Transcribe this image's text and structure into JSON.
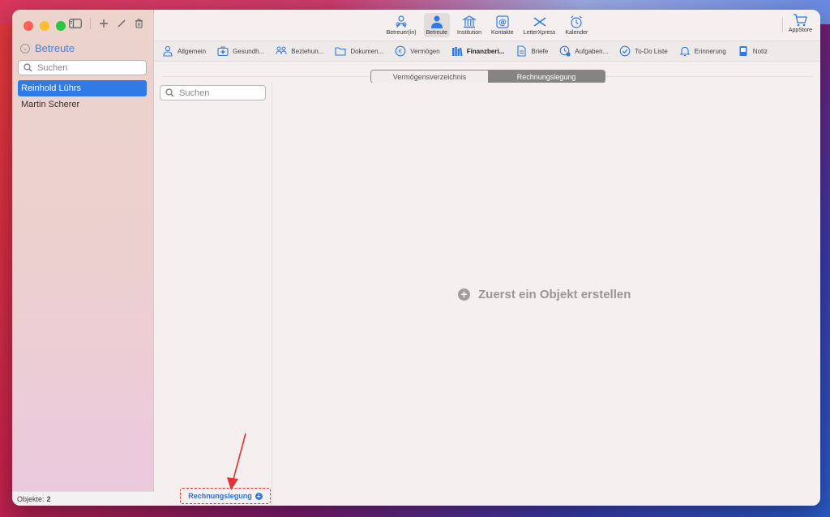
{
  "sidebar": {
    "title": "Betreute",
    "search_placeholder": "Suchen",
    "items": [
      {
        "label": "Reinhold Lührs",
        "selected": true
      },
      {
        "label": "Martin Scherer",
        "selected": false
      }
    ],
    "footer_label": "Objekte:",
    "footer_count": "2"
  },
  "toolbar": {
    "buttons": [
      {
        "label": "Betreuer(in)",
        "icon": "people-icon"
      },
      {
        "label": "Betreute",
        "icon": "person-icon",
        "active": true
      },
      {
        "label": "Institution",
        "icon": "building-icon"
      },
      {
        "label": "Kontakte",
        "icon": "at-icon"
      },
      {
        "label": "LetterXpress",
        "icon": "letterxpress-icon"
      },
      {
        "label": "Kalender",
        "icon": "alarm-icon"
      }
    ],
    "appstore_label": "AppStore"
  },
  "tabs": [
    {
      "label": "Allgemein",
      "icon": "person-outline-icon"
    },
    {
      "label": "Gesundh...",
      "icon": "medical-kit-icon"
    },
    {
      "label": "Beziehun...",
      "icon": "relations-icon"
    },
    {
      "label": "Dokumen...",
      "icon": "folder-icon"
    },
    {
      "label": "Vermögen",
      "icon": "euro-icon"
    },
    {
      "label": "Finanzberi...",
      "icon": "books-icon",
      "active": true
    },
    {
      "label": "Briefe",
      "icon": "document-icon"
    },
    {
      "label": "Aufgaben...",
      "icon": "clock-check-icon"
    },
    {
      "label": "To-Do Liste",
      "icon": "checkmark-circle-icon"
    },
    {
      "label": "Erinnerung",
      "icon": "bell-icon"
    },
    {
      "label": "Notiz",
      "icon": "notepad-icon"
    }
  ],
  "segments": [
    {
      "label": "Vermögensverzeichnis",
      "active": false
    },
    {
      "label": "Rechnungslegung",
      "active": true
    }
  ],
  "list": {
    "search_placeholder": "Suchen",
    "footer_label": "Rechnungslegung"
  },
  "detail": {
    "empty_message": "Zuerst ein Objekt erstellen"
  },
  "colors": {
    "accent": "#2f7ae5",
    "annotation": "#e33333"
  }
}
